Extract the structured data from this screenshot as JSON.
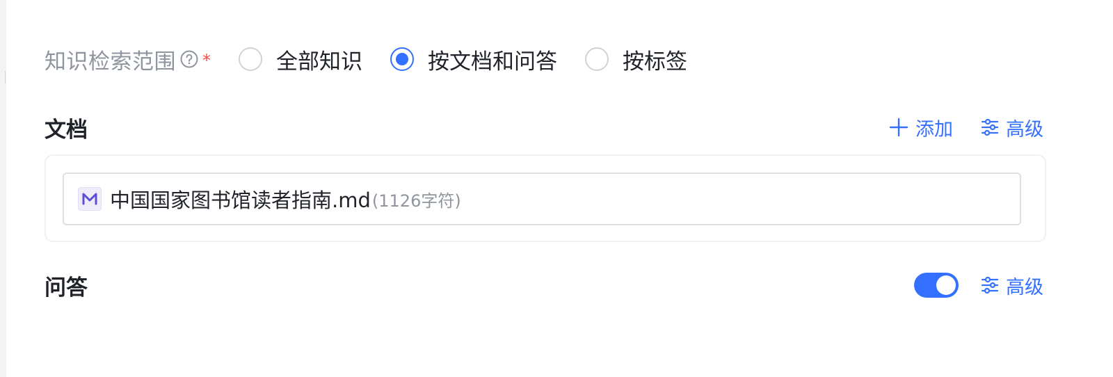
{
  "scope": {
    "label": "知识检索范围",
    "required_mark": "*",
    "options": [
      {
        "label": "全部知识",
        "checked": false
      },
      {
        "label": "按文档和问答",
        "checked": true
      },
      {
        "label": "按标签",
        "checked": false
      }
    ]
  },
  "docs": {
    "title": "文档",
    "add_label": "添加",
    "advanced_label": "高级",
    "items": [
      {
        "icon_letter": "M",
        "name": "中国国家图书馆读者指南.md",
        "char_count": "(1126字符)"
      }
    ]
  },
  "qa": {
    "title": "问答",
    "toggle_on": true,
    "advanced_label": "高级"
  },
  "colors": {
    "accent": "#3370ff",
    "required": "#f54a45",
    "muted_text": "#8f959e",
    "md_icon": "#5b4fd6"
  },
  "icons": {
    "help": "question-circle-icon",
    "add": "plus-icon",
    "advanced": "sliders-icon",
    "doc": "markdown-file-icon"
  }
}
